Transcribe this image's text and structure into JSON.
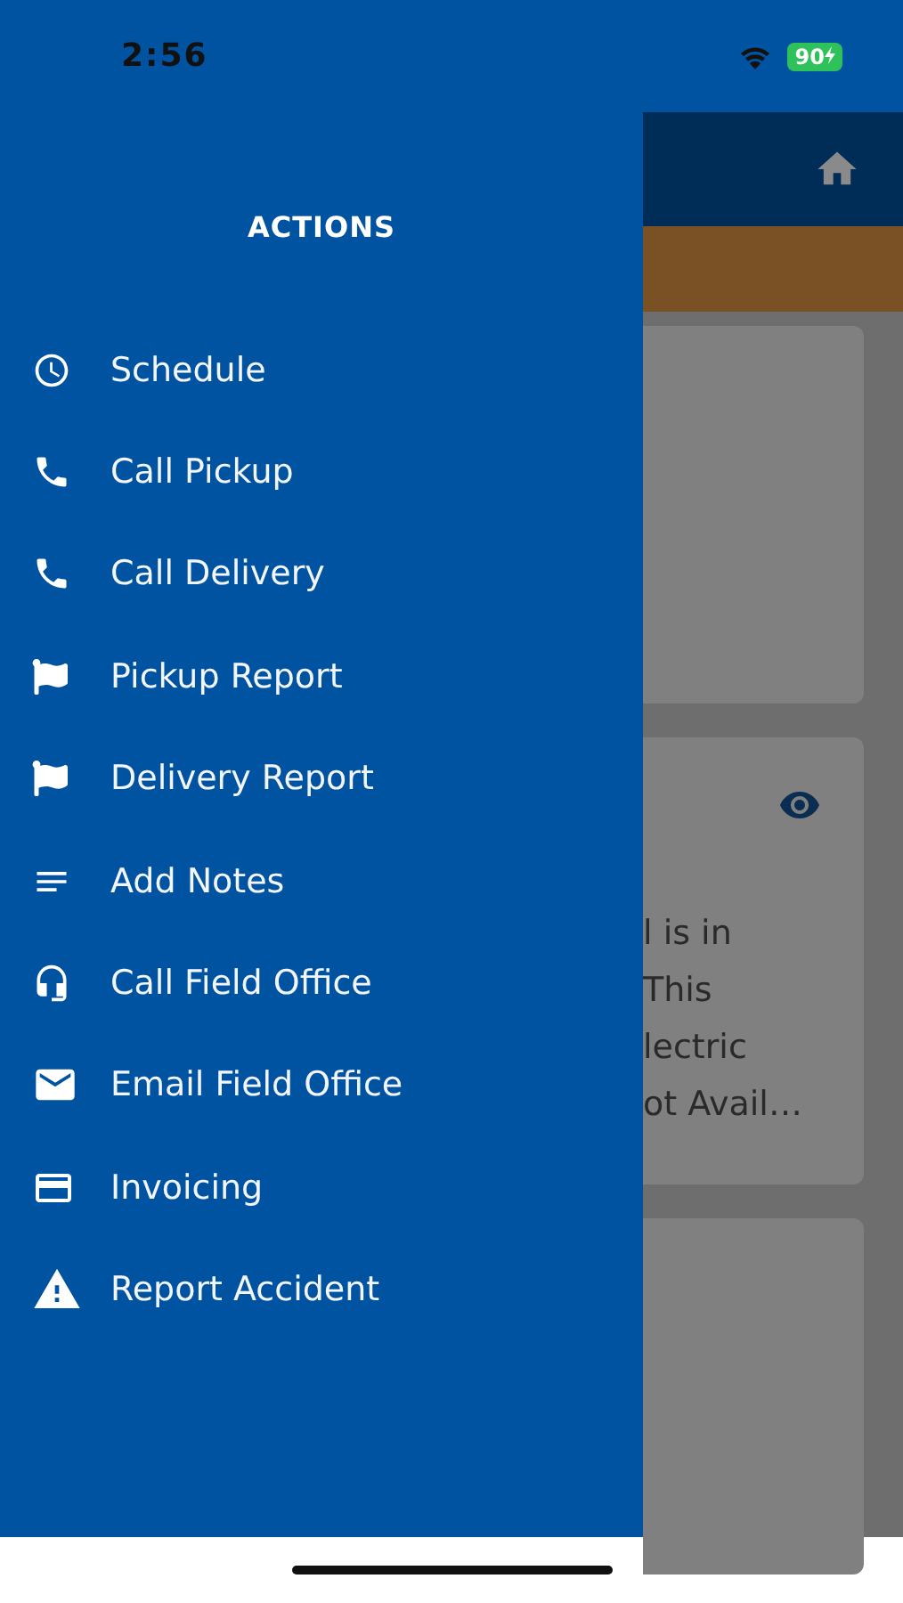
{
  "status_bar": {
    "time": "2:56",
    "battery": "90"
  },
  "drawer": {
    "title": "ACTIONS",
    "items": [
      {
        "label": "Schedule"
      },
      {
        "label": "Call Pickup"
      },
      {
        "label": "Call Delivery"
      },
      {
        "label": "Pickup Report"
      },
      {
        "label": "Delivery Report"
      },
      {
        "label": "Add Notes"
      },
      {
        "label": "Call Field Office"
      },
      {
        "label": "Email Field Office"
      },
      {
        "label": "Invoicing"
      },
      {
        "label": "Report Accident"
      }
    ]
  },
  "background_card": {
    "lines": [
      "l is in",
      "This",
      "lectric",
      "ot Avail…"
    ]
  }
}
